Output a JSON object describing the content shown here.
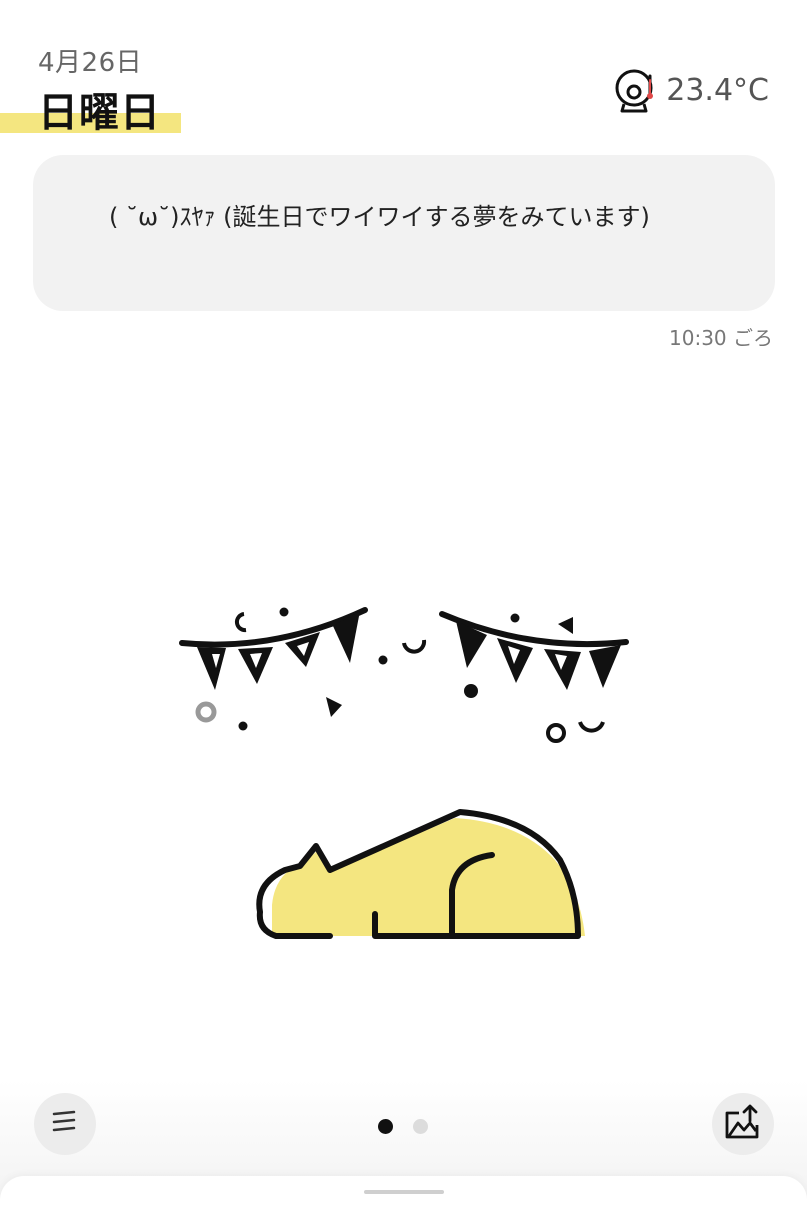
{
  "header": {
    "date": "4月26日",
    "weekday": "日曜日",
    "temperature": "23.4°C",
    "weather_icon": "thermometer-gauge-icon"
  },
  "colors": {
    "accent_yellow": "#f4e680",
    "bubble_bg": "#f2f2f2",
    "thermo_red": "#e04848"
  },
  "message": {
    "text": "( ˘ω˘)ｽﾔｧ (誕生日でワイワイする夢をみています)",
    "time": "10:30 ごろ"
  },
  "illustration": {
    "icon": "sleeping-cat-with-bunting-illustration"
  },
  "footer": {
    "menu_icon": "menu-lines-icon",
    "share_icon": "share-image-icon",
    "pager": {
      "total": 2,
      "current": 1
    }
  }
}
